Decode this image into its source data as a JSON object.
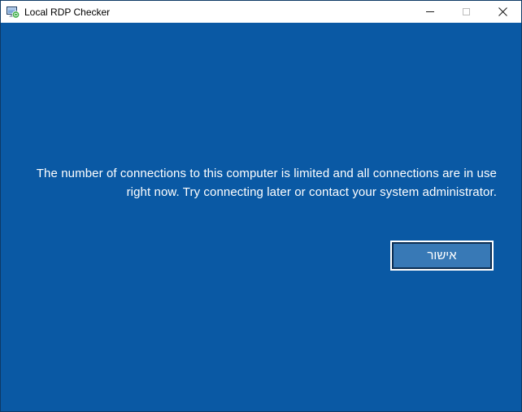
{
  "window": {
    "title": "Local RDP Checker"
  },
  "titlebar": {
    "icons": {
      "app": "rdp-computer-with-green-refresh-badge",
      "minimize": "minimize-line",
      "maximize": "maximize-square-disabled",
      "close": "close-x"
    }
  },
  "message": {
    "line1": "The number of connections to this computer is limited and all connections are in use",
    "line2": "right now. Try connecting later or contact your system administrator."
  },
  "button": {
    "label": "אישור"
  },
  "colors": {
    "background": "#0A59A4",
    "button_fill": "#3879B6",
    "button_border_dark": "#0D2E52",
    "window_border": "#0E3A66",
    "title_text": "#000000",
    "message_text": "#FFFFFF"
  }
}
